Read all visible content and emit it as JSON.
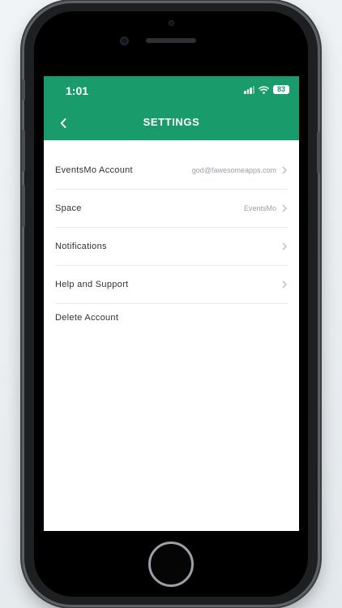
{
  "status_bar": {
    "time": "1:01",
    "battery": "83"
  },
  "header": {
    "title": "SETTINGS"
  },
  "settings": [
    {
      "label": "EventsMo Account",
      "value": "god@fawesomeapps.com",
      "chevron": true
    },
    {
      "label": "Space",
      "value": "EventsMo",
      "chevron": true
    },
    {
      "label": "Notifications",
      "value": "",
      "chevron": true
    },
    {
      "label": "Help and Support",
      "value": "",
      "chevron": true
    },
    {
      "label": "Delete Account",
      "value": "",
      "chevron": false
    }
  ],
  "colors": {
    "accent": "#1a9b6c",
    "background": "#ffffff",
    "text": "#2e3236",
    "muted": "#9aa0a6"
  },
  "icons": [
    "back-chevron-icon",
    "signal-icon",
    "wifi-icon",
    "battery-icon",
    "chevron-right-icon"
  ]
}
